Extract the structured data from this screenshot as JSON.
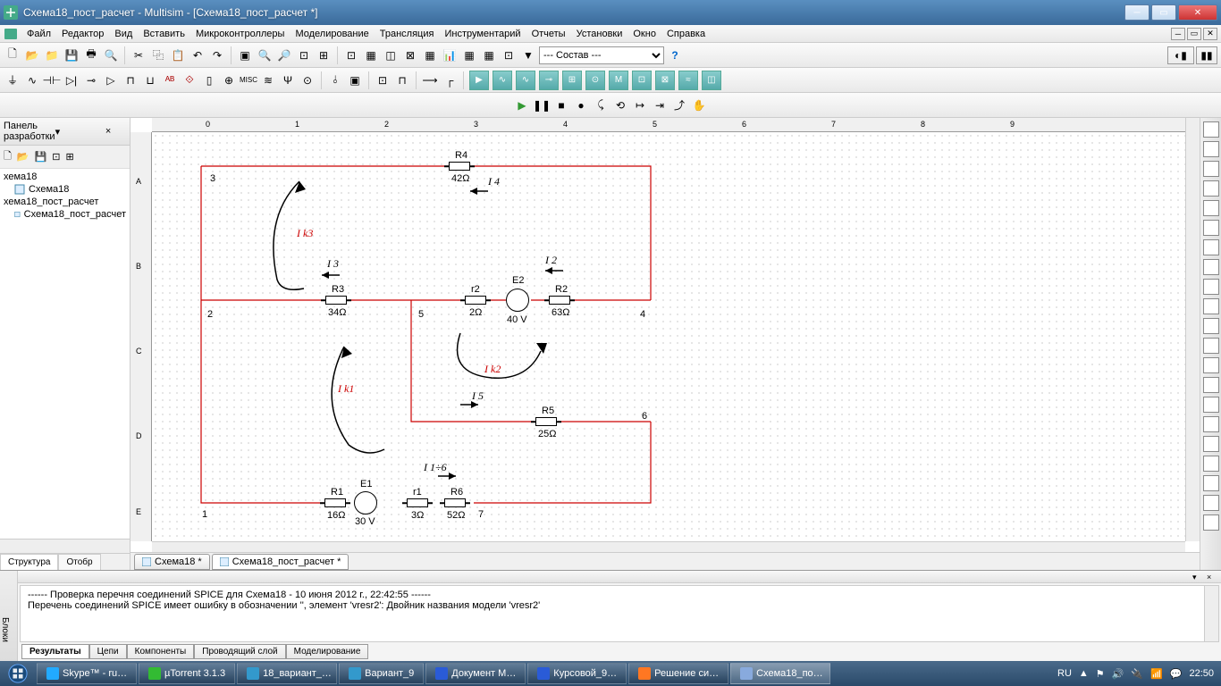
{
  "window": {
    "title": "Схема18_пост_расчет - Multisim - [Схема18_пост_расчет *]"
  },
  "menu": [
    "Файл",
    "Редактор",
    "Вид",
    "Вставить",
    "Микроконтроллеры",
    "Моделирование",
    "Трансляция",
    "Инструментарий",
    "Отчеты",
    "Установки",
    "Окно",
    "Справка"
  ],
  "combo_status": "--- Состав ---",
  "left": {
    "title": "Панель разработки",
    "tree": [
      {
        "name": "хема18",
        "child": false
      },
      {
        "name": "Схема18",
        "child": true
      },
      {
        "name": "хема18_пост_расчет",
        "child": false
      },
      {
        "name": "Схема18_пост_расчет",
        "child": true
      }
    ],
    "tabs": [
      "Структура",
      "Отобр"
    ]
  },
  "doc_tabs": [
    "Схема18 *",
    "Схема18_пост_расчет *"
  ],
  "ruler_h": [
    "0",
    "1",
    "2",
    "3",
    "4",
    "5",
    "6",
    "7",
    "8",
    "9"
  ],
  "ruler_v": [
    "A",
    "B",
    "C",
    "D",
    "E"
  ],
  "circuit": {
    "components": {
      "R4": {
        "name": "R4",
        "value": "42Ω"
      },
      "R3": {
        "name": "R3",
        "value": "34Ω"
      },
      "r2": {
        "name": "r2",
        "value": "2Ω"
      },
      "E2": {
        "name": "E2",
        "value": "40 V"
      },
      "R2": {
        "name": "R2",
        "value": "63Ω"
      },
      "R5": {
        "name": "R5",
        "value": "25Ω"
      },
      "R1": {
        "name": "R1",
        "value": "16Ω"
      },
      "E1": {
        "name": "E1",
        "value": "30 V"
      },
      "r1": {
        "name": "r1",
        "value": "3Ω"
      },
      "R6": {
        "name": "R6",
        "value": "52Ω"
      }
    },
    "nodes": {
      "n1": "1",
      "n2": "2",
      "n3": "3",
      "n4": "4",
      "n5": "5",
      "n6": "6",
      "n7": "7"
    },
    "currents": {
      "I4": "I 4",
      "I3": "I 3",
      "I2": "I 2",
      "I5": "I 5",
      "I16": "I 1÷6",
      "Ik1": "I k1",
      "Ik2": "I k2",
      "Ik3": "I k3"
    }
  },
  "log": {
    "line1": "------ Проверка перечня соединений SPICE для Схема18 - 10 июня 2012 г., 22:42:55 ------",
    "line2": "Перечень соединений SPICE имеет ошибку в обозначении '', элемент 'vresr2':  Двойник названия модели 'vresr2'"
  },
  "bottom_tabs": [
    "Результаты",
    "Цепи",
    "Компоненты",
    "Проводящий слой",
    "Моделирование"
  ],
  "bottom_side": "Блоки",
  "taskbar": [
    {
      "label": "Skype™ - ru…",
      "color": "#2af"
    },
    {
      "label": "µTorrent 3.1.3",
      "color": "#3b3"
    },
    {
      "label": "18_вариант_…",
      "color": "#39c"
    },
    {
      "label": "Вариант_9",
      "color": "#39c"
    },
    {
      "label": "Документ M…",
      "color": "#2a5bd7"
    },
    {
      "label": "Курсовой_9…",
      "color": "#2a5bd7"
    },
    {
      "label": "Решение си…",
      "color": "#f72"
    },
    {
      "label": "Схема18_по…",
      "color": "#8ad",
      "active": true
    }
  ],
  "tray": {
    "lang": "RU",
    "time": "22:50"
  }
}
